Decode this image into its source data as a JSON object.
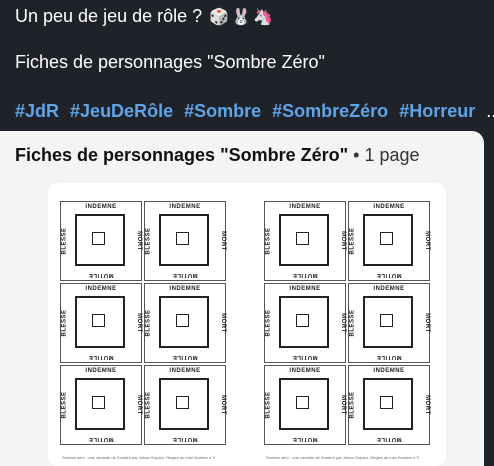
{
  "post": {
    "intro": "Un peu de jeu de rôle ?",
    "emojis": [
      "🎲",
      "🐰",
      "🦄"
    ],
    "subtitle": "Fiches de personnages \"Sombre Zéro\"",
    "hashtags": [
      "#JdR",
      "#JeuDeRôle",
      "#Sombre",
      "#SombreZéro",
      "#Horreur"
    ],
    "ellipsis": "..."
  },
  "attachment": {
    "title": "Fiches de personnages \"Sombre Zéro\"",
    "meta": " • 1 page",
    "labels": {
      "top": "INDEMNE",
      "left": "BLESSE",
      "right": "MORT",
      "bottom": "MUTILE"
    },
    "footer": "Sombre zéro : une variante de Sombre par Johan Scipion. Règles du mini Sombre n°2"
  }
}
